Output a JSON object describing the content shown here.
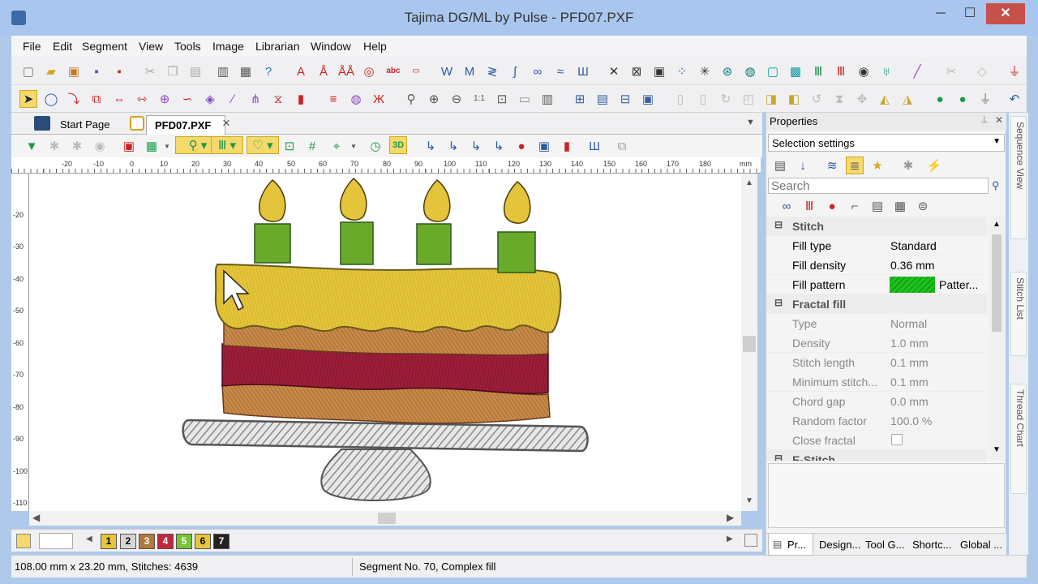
{
  "window": {
    "title": "Tajima DG/ML by Pulse - PFD07.PXF",
    "minimize": "─",
    "maximize": "☐",
    "close": "✕"
  },
  "menu": [
    "File",
    "Edit",
    "Segment",
    "View",
    "Tools",
    "Image",
    "Librarian",
    "Window",
    "Help"
  ],
  "doc_tabs": {
    "start": "Start Page",
    "active": "PFD07.PXF",
    "close": "×"
  },
  "ruler": {
    "h_ticks": [
      "-20",
      "-10",
      "0",
      "10",
      "20",
      "30",
      "40",
      "50",
      "60",
      "70",
      "80",
      "90",
      "100",
      "110",
      "120",
      "130",
      "140",
      "150",
      "160",
      "170",
      "180",
      "mm"
    ],
    "v_ticks": [
      "-20",
      "-30",
      "-40",
      "-50",
      "-60",
      "-70",
      "-80",
      "-90",
      "-100",
      "-110"
    ]
  },
  "color_chips": [
    {
      "n": "1",
      "c": "#e8c43a"
    },
    {
      "n": "2",
      "c": "#d6d6d6"
    },
    {
      "n": "3",
      "c": "#b07a3a"
    },
    {
      "n": "4",
      "c": "#c0263c"
    },
    {
      "n": "5",
      "c": "#77c436"
    },
    {
      "n": "6",
      "c": "#e8c43a"
    },
    {
      "n": "7",
      "c": "#222222"
    }
  ],
  "status": {
    "dims": "108.00 mm x 23.20 mm, Stitches: 4639",
    "segment": "Segment No. 70, Complex fill"
  },
  "properties": {
    "title": "Properties",
    "selection": "Selection settings",
    "search_placeholder": "Search",
    "groups": [
      {
        "name": "Stitch",
        "rows": [
          {
            "name": "Fill type",
            "value": "Standard",
            "disabled": false
          },
          {
            "name": "Fill density",
            "value": "0.36 mm",
            "disabled": false
          },
          {
            "name": "Fill pattern",
            "value": "Patter...",
            "disabled": false,
            "swatch": "#1fc41f"
          }
        ]
      },
      {
        "name": "Fractal fill",
        "rows": [
          {
            "name": "Type",
            "value": "Normal",
            "disabled": true
          },
          {
            "name": "Density",
            "value": "1.0 mm",
            "disabled": true
          },
          {
            "name": "Stitch length",
            "value": "0.1 mm",
            "disabled": true
          },
          {
            "name": "Minimum stitch...",
            "value": "0.1 mm",
            "disabled": true
          },
          {
            "name": "Chord gap",
            "value": "0.0 mm",
            "disabled": true
          },
          {
            "name": "Random factor",
            "value": "100.0 %",
            "disabled": true
          },
          {
            "name": "Close fractal",
            "value": "",
            "disabled": true,
            "checkbox": true
          }
        ]
      },
      {
        "name": "E-Stitch",
        "rows": []
      }
    ],
    "bottom_tabs": [
      "Pr...",
      "Design...",
      "Tool G...",
      "Shortc...",
      "Global ..."
    ]
  },
  "side_tabs": [
    "Sequence View",
    "Stitch List",
    "Thread Chart"
  ]
}
